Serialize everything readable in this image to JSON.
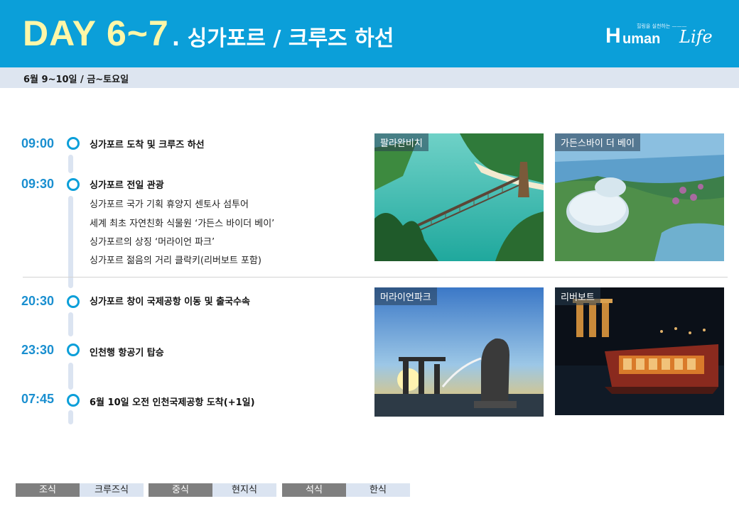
{
  "header": {
    "day": "DAY 6~7",
    "subtitle": ". 싱가포르 / 크루즈 하선",
    "logo": {
      "tagline": "힐링을 실천하는 ———",
      "h": "H",
      "uman": "uman",
      "life": "Life"
    }
  },
  "date_line": "6월 9~10일 / 금~토요일",
  "schedule": [
    {
      "time": "09:00",
      "items": [
        {
          "text": "싱가포르 도착 및 크루즈 하선",
          "bold": true
        }
      ]
    },
    {
      "time": "09:30",
      "items": [
        {
          "text": "싱가포르 전일 관광",
          "bold": true
        },
        {
          "text": "싱가포르 국가 기획 휴양지 센토사 섬투어",
          "bold": false
        },
        {
          "text": "세계 최초 자연친화 식물원 ‘가든스 바이더 베이’",
          "bold": false
        },
        {
          "text": "싱가포르의 상징 ‘머라이언 파크’",
          "bold": false
        },
        {
          "text": "싱가포르 젊음의 거리 클락키(리버보트 포함)",
          "bold": false
        }
      ]
    },
    {
      "time": "20:30",
      "items": [
        {
          "text": "싱가포르 창이 국제공항 이동 및 출국수속",
          "bold": true
        }
      ]
    },
    {
      "time": "23:30",
      "items": [
        {
          "text": "인천행 항공기 탑승",
          "bold": true
        }
      ]
    },
    {
      "time": "07:45",
      "items": [
        {
          "text": "6월 10일 오전 인천국제공항 도착(+1일)",
          "bold": true
        }
      ]
    }
  ],
  "photos": [
    {
      "label": "팔라완비치",
      "icon": "palawan-beach-photo"
    },
    {
      "label": "가든스바이 더 베이",
      "icon": "gardens-by-the-bay-photo"
    },
    {
      "label": "머라이언파크",
      "icon": "merlion-park-photo"
    },
    {
      "label": "리버보트",
      "icon": "river-boat-photo"
    }
  ],
  "meals": [
    {
      "key": "조식",
      "value": "크루즈식"
    },
    {
      "key": "중식",
      "value": "현지식"
    },
    {
      "key": "석식",
      "value": "한식"
    }
  ],
  "colors": {
    "header": "#0b9fd9",
    "day_title": "#fff7a8",
    "time": "#1a8fd0",
    "subbar": "#dde5f0",
    "meal_key": "#7f7f7f",
    "meal_value": "#dbe4f1"
  }
}
